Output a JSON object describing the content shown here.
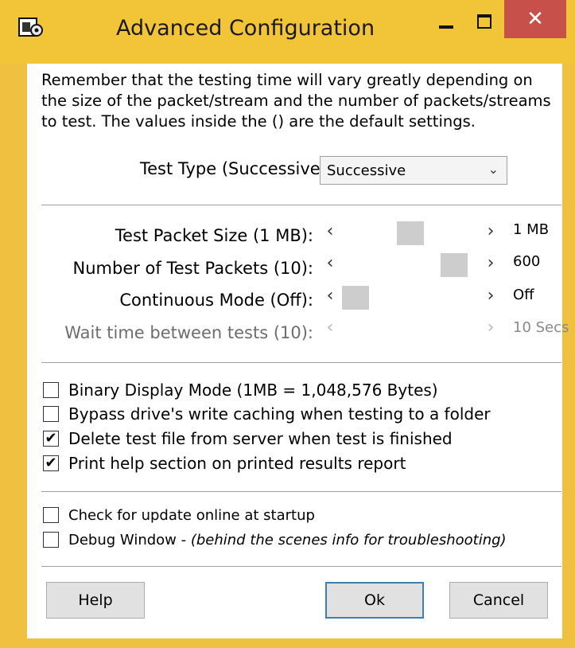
{
  "window": {
    "title": "Advanced Configuration",
    "icon": "app-gear-icon",
    "close_glyph": "✕"
  },
  "intro_text": "Remember that the testing time will vary greatly depending on the size of the packet/stream and the number of packets/streams to test.  The values inside the () are the default settings.",
  "test_type": {
    "label": "Test Type (Successive):",
    "value": "Successive",
    "arrow": "⌄"
  },
  "sliders": [
    {
      "label": "Test Packet Size (1 MB):",
      "value_text": "1 MB",
      "position": 0.5,
      "enabled": true
    },
    {
      "label": "Number of Test Packets (10):",
      "value_text": "600",
      "position": 0.9,
      "enabled": true
    },
    {
      "label": "Continuous Mode (Off):",
      "value_text": "Off",
      "position": 0.0,
      "enabled": true
    },
    {
      "label": "Wait time between tests (10):",
      "value_text": "10 Secs",
      "position": 0.0,
      "enabled": false
    }
  ],
  "arrows": {
    "left": "‹",
    "right": "›"
  },
  "options": [
    {
      "label": "Binary Display Mode (1MB = 1,048,576 Bytes)",
      "checked": false
    },
    {
      "label": "Bypass drive's write caching when testing to a folder",
      "checked": false
    },
    {
      "label": "Delete test file from server when test is finished",
      "checked": true
    },
    {
      "label": "Print help section on printed results report",
      "checked": true
    }
  ],
  "misc_options": [
    {
      "label": "Check for update online at startup",
      "checked": false
    },
    {
      "label": "Debug Window - ",
      "note": "(behind the scenes info for troubleshooting)",
      "checked": false
    }
  ],
  "check_glyph": "✔",
  "buttons": {
    "help": "Help",
    "ok": "Ok",
    "cancel": "Cancel"
  },
  "colors": {
    "titlebar": "#f2c438",
    "close": "#c7504a",
    "default_button_border": "#3c7fb1"
  }
}
